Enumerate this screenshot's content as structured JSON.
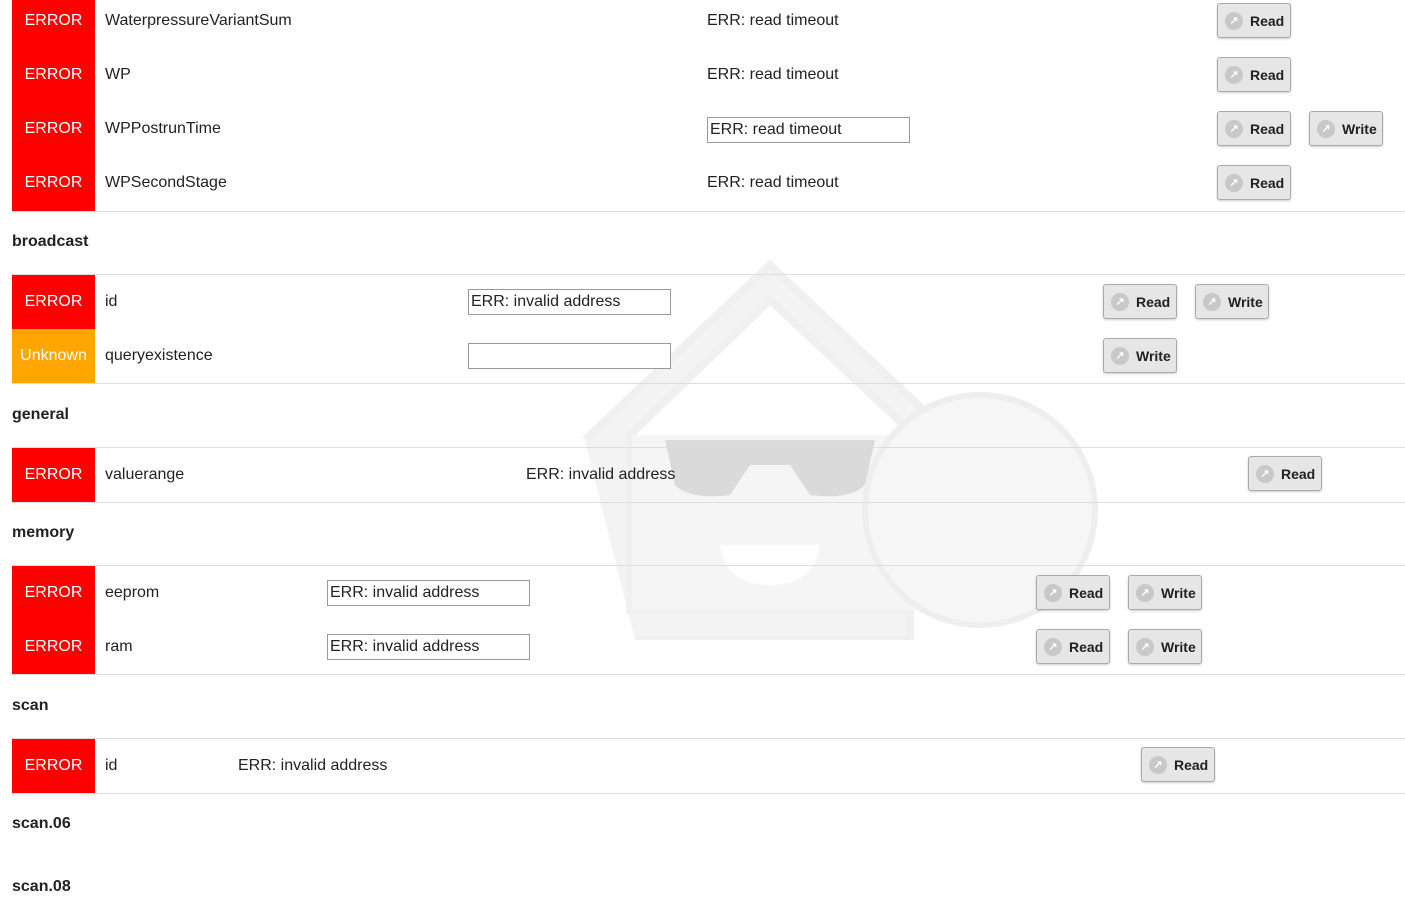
{
  "groups": [
    {
      "rows": [
        {
          "status": "ERROR",
          "name": "WaterpressureVariantSum",
          "value": "ERR: read timeout",
          "buttons": [
            "Read"
          ]
        },
        {
          "status": "ERROR",
          "name": "WP",
          "value": "ERR: read timeout",
          "buttons": [
            "Read"
          ]
        },
        {
          "status": "ERROR",
          "name": "WPPostrunTime",
          "value": "ERR: read timeout",
          "buttons": [
            "Read",
            "Write"
          ]
        },
        {
          "status": "ERROR",
          "name": "WPSecondStage",
          "value": "ERR: read timeout",
          "buttons": [
            "Read"
          ]
        }
      ]
    },
    {
      "title": "broadcast",
      "rows": [
        {
          "status": "ERROR",
          "name": "id",
          "value": "ERR: invalid address",
          "buttons": [
            "Read",
            "Write"
          ]
        },
        {
          "status": "Unknown",
          "name": "queryexistence",
          "value": "",
          "buttons": [
            "Write"
          ]
        }
      ]
    },
    {
      "title": "general",
      "rows": [
        {
          "status": "ERROR",
          "name": "valuerange",
          "value": "ERR: invalid address",
          "buttons": [
            "Read"
          ]
        }
      ]
    },
    {
      "title": "memory",
      "rows": [
        {
          "status": "ERROR",
          "name": "eeprom",
          "value": "ERR: invalid address",
          "buttons": [
            "Read",
            "Write"
          ]
        },
        {
          "status": "ERROR",
          "name": "ram",
          "value": "ERR: invalid address",
          "buttons": [
            "Read",
            "Write"
          ]
        }
      ]
    },
    {
      "title": "scan",
      "rows": [
        {
          "status": "ERROR",
          "name": "id",
          "value": "ERR: invalid address",
          "buttons": [
            "Read"
          ]
        }
      ]
    },
    {
      "title": "scan.06"
    },
    {
      "title": "scan.08"
    }
  ],
  "colors": {
    "error": "#ff0000",
    "unknown": "#ffa500"
  }
}
